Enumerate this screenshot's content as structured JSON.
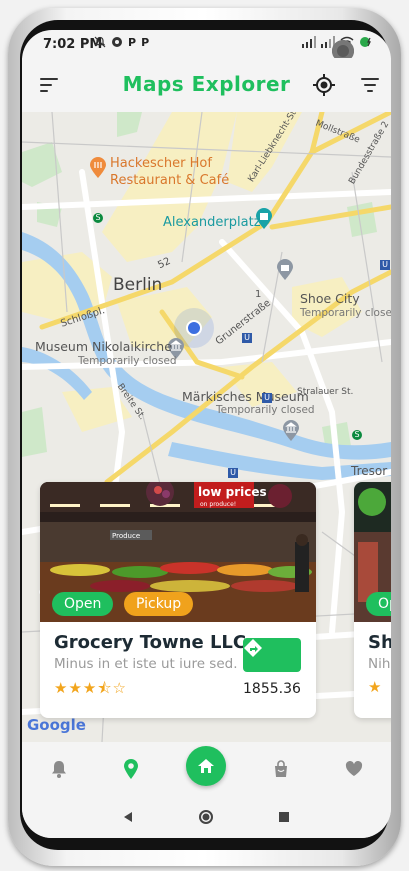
{
  "status": {
    "time": "7:02 PM",
    "notifications": [
      "bell-slash-icon",
      "circle-icon",
      "p-icon",
      "p-icon"
    ],
    "p_letter": "P"
  },
  "appbar": {
    "title": "Maps Explorer",
    "left_icon": "menu-icon",
    "locate_icon": "crosshair-icon",
    "filter_icon": "filter-icon"
  },
  "map": {
    "labels": {
      "hackescher_1": "Hackescher Hof",
      "hackescher_2": "Restaurant & Café",
      "alexanderplatz": "Alexanderplatz",
      "berlin": "Berlin",
      "shoe_city": "Shoe City",
      "shoe_city_status": "Temporarily closed",
      "museum_nik": "Museum Nikolaikirche",
      "museum_nik_status": "Temporarily closed",
      "maerkisches": "Märkisches Museum",
      "maerkisches_status": "Temporarily closed",
      "schlossp": "Schloßpl.",
      "grunerstr": "Grunerstraße",
      "karl_lieb": "Karl-Liebknecht-Str.",
      "mollstr": "Mollstraße",
      "bundesstr": "Bundesstraße 2",
      "road52": "52",
      "road1": "1",
      "breite": "Breite St.",
      "stralauer": "Stralauer St.",
      "tresor": "Tresor",
      "google": "Google",
      "u": "U",
      "s": "S"
    }
  },
  "cards": [
    {
      "status": "Open",
      "service": "Pickup",
      "title": "Grocery Towne LLC",
      "description": "Minus in et iste ut iure sed.",
      "rating": "★★★⯪☆",
      "distance": "1855.36",
      "sign_text": "low prices",
      "sign_sub": "on produce!",
      "shelf_tag": "Produce"
    },
    {
      "status": "Op",
      "title": "Sh",
      "description": "Nih",
      "rating": "★"
    }
  ],
  "bottomnav": {
    "items": [
      "bell-icon",
      "location-pin-icon",
      "home-icon",
      "shopping-bag-icon",
      "heart-icon"
    ]
  },
  "colors": {
    "accent": "#1fbf5e",
    "pickup": "#f0a21c",
    "star": "#f2a51d"
  }
}
